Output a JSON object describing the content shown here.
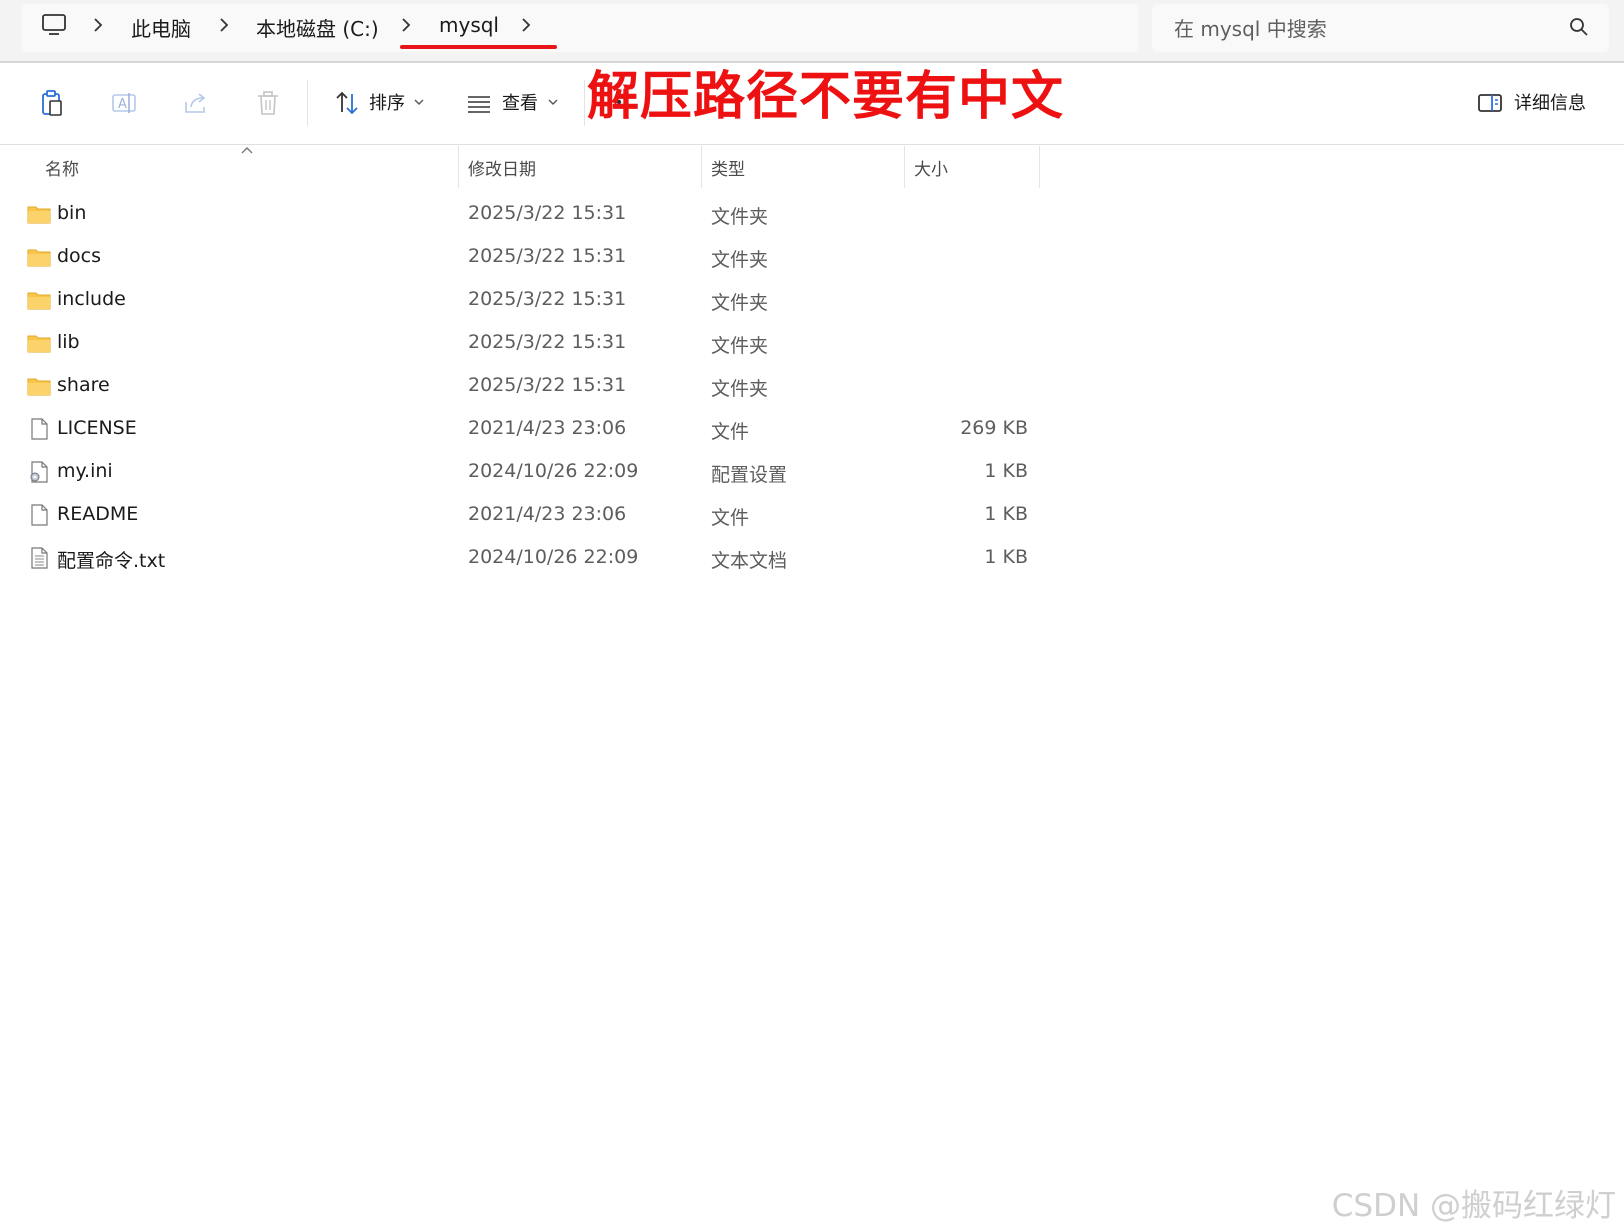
{
  "address_bar": {
    "breadcrumbs": [
      "此电脑",
      "本地磁盘 (C:)",
      "mysql"
    ],
    "search_placeholder": "在 mysql 中搜索"
  },
  "toolbar": {
    "sort_label": "排序",
    "view_label": "查看",
    "details_label": "详细信息"
  },
  "annotation": "解压路径不要有中文",
  "columns": {
    "name": "名称",
    "date": "修改日期",
    "type": "类型",
    "size": "大小"
  },
  "files": [
    {
      "name": "bin",
      "date": "2025/3/22 15:31",
      "type": "文件夹",
      "size": "",
      "icon": "folder-icon"
    },
    {
      "name": "docs",
      "date": "2025/3/22 15:31",
      "type": "文件夹",
      "size": "",
      "icon": "folder-icon"
    },
    {
      "name": "include",
      "date": "2025/3/22 15:31",
      "type": "文件夹",
      "size": "",
      "icon": "folder-icon"
    },
    {
      "name": "lib",
      "date": "2025/3/22 15:31",
      "type": "文件夹",
      "size": "",
      "icon": "folder-icon"
    },
    {
      "name": "share",
      "date": "2025/3/22 15:31",
      "type": "文件夹",
      "size": "",
      "icon": "folder-icon"
    },
    {
      "name": "LICENSE",
      "date": "2021/4/23 23:06",
      "type": "文件",
      "size": "269 KB",
      "icon": "file-icon"
    },
    {
      "name": "my.ini",
      "date": "2024/10/26 22:09",
      "type": "配置设置",
      "size": "1 KB",
      "icon": "config-file-icon"
    },
    {
      "name": "README",
      "date": "2021/4/23 23:06",
      "type": "文件",
      "size": "1 KB",
      "icon": "file-icon"
    },
    {
      "name": "配置命令.txt",
      "date": "2024/10/26 22:09",
      "type": "文本文档",
      "size": "1 KB",
      "icon": "text-file-icon"
    }
  ],
  "watermark": "CSDN @搬码红绿灯",
  "colors": {
    "annotation_red": "#ee1111",
    "folder_yellow": "#f8c74a",
    "accent_blue": "#2a6fdb"
  }
}
